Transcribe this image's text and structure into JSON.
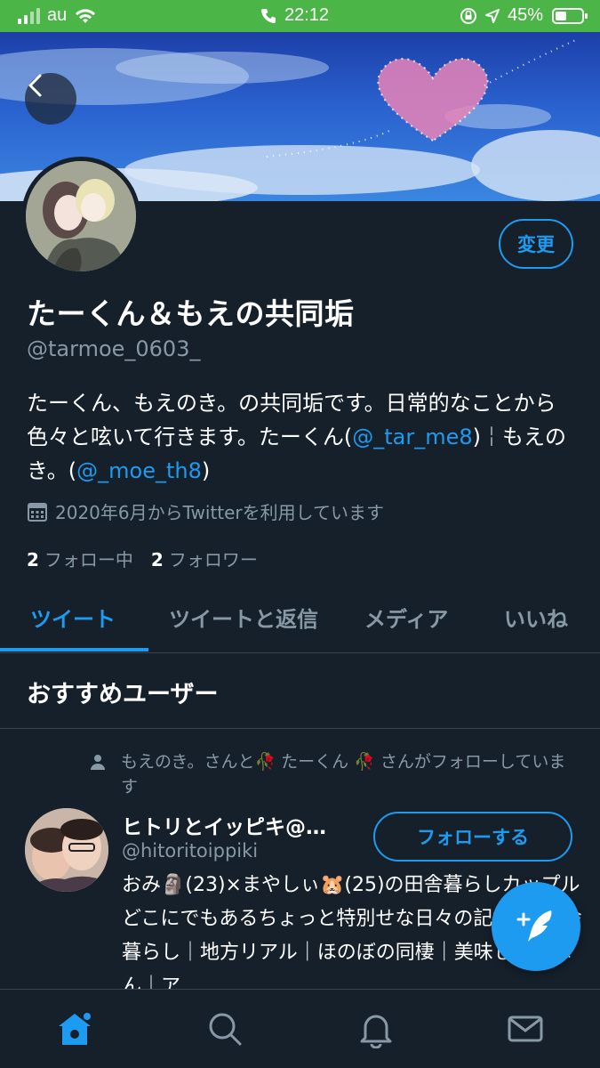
{
  "status_bar": {
    "carrier": "au",
    "time": "22:12",
    "battery": "45%",
    "wifi_icon": "wifi-icon",
    "phone_icon": "phone-icon",
    "location_icon": "location-arrow-icon",
    "lock_icon": "rotation-lock-icon",
    "background_color": "#4cb548"
  },
  "profile": {
    "name": "たーくん＆もえの共同垢",
    "handle": "@tarmoe_0603_",
    "bio_parts": {
      "text1": "たーくん、もえのき。の共同垢です。日常的なことから色々と呟いて行きます。たーくん(",
      "mention1": "@_tar_me8",
      "text2": ")￤もえのき。(",
      "mention2": "@_moe_th8",
      "text3": ")"
    },
    "joined": "2020年6月からTwitterを利用しています",
    "following_count": "2",
    "following_label": "フォロー中",
    "followers_count": "2",
    "followers_label": "フォロワー",
    "edit_label": "変更"
  },
  "tabs": [
    {
      "label": "ツイート",
      "active": true
    },
    {
      "label": "ツイートと返信",
      "active": false
    },
    {
      "label": "メディア",
      "active": false
    },
    {
      "label": "いいね",
      "active": false
    }
  ],
  "recommended": {
    "title": "おすすめユーザー",
    "social_context": "もえのき。さんと🥀 たーくん 🥀 さんがフォローしています",
    "user": {
      "name": "ヒトリとイッピキ@…",
      "handle": "@hitoritoippiki",
      "follow_label": "フォローする",
      "bio": "おみ🗿(23)×まやしぃ🐹(25)の田舎暮らしカップル どこにでもあるちょっと特別せな日々の記録🌿 田舎暮らし｜地方リアル｜ほのぼの同棲｜美味しいごはん｜ア"
    }
  },
  "bottom_nav": [
    {
      "icon": "home-icon",
      "active": true
    },
    {
      "icon": "search-icon",
      "active": false
    },
    {
      "icon": "bell-icon",
      "active": false
    },
    {
      "icon": "mail-icon",
      "active": false
    }
  ],
  "colors": {
    "accent": "#1d9bf0",
    "background": "#15202b",
    "secondary_text": "#8899a6",
    "border": "#38444d"
  }
}
